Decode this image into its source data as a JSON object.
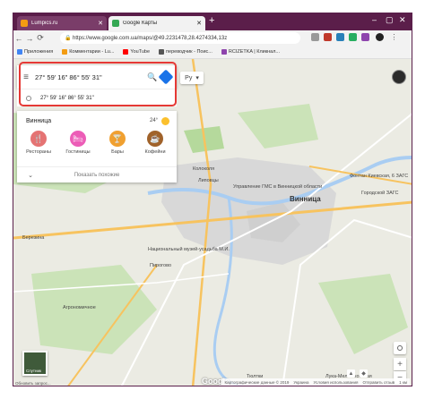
{
  "tabs": [
    {
      "label": "Lumpics.ru",
      "active": false,
      "color": "#f39c12"
    },
    {
      "label": "Google Карты",
      "active": true,
      "color": "#34a853"
    }
  ],
  "omnibox": {
    "url": "https://www.google.com.ua/maps/@49.2231478,28.4274334,13z"
  },
  "bookmarks": [
    {
      "label": "Приложения",
      "color": "#4285f4"
    },
    {
      "label": "Комментарии - Lu...",
      "color": "#f39c12"
    },
    {
      "label": "YouTube",
      "color": "#ff0000"
    },
    {
      "label": "переводчик - Поис...",
      "color": "#555555"
    },
    {
      "label": "RCIZETKA | Кликнал...",
      "color": "#8e44ad"
    }
  ],
  "search": {
    "query": "27° 59' 16\" 86° 55' 31\"",
    "suggestion": "27° 59' 16\" 86° 55' 31\""
  },
  "lang": {
    "label": "Ру"
  },
  "panel": {
    "city": "Винница",
    "temp": "24°",
    "categories": [
      {
        "label": "Рестораны",
        "icon": "fork-icon",
        "color": "#e57373",
        "glyph": "🍴"
      },
      {
        "label": "Гостиницы",
        "icon": "bed-icon",
        "color": "#ec5db7",
        "glyph": "🛏"
      },
      {
        "label": "Бары",
        "icon": "cocktail-icon",
        "color": "#f0a030",
        "glyph": "🍸"
      },
      {
        "label": "Кофейни",
        "icon": "coffee-icon",
        "color": "#a0622a",
        "glyph": "☕"
      }
    ],
    "more": "Показать похожие"
  },
  "map_labels": {
    "vinnitsa": "Винница",
    "lipovtsy": "Липовцы",
    "upravlenie": "Управление ГМС в Винницкой области",
    "kolokolnya": "Колоколя",
    "museum": "Национальный музей-усадьба М.И.",
    "pyrogovo": "Пирогово",
    "agronomichne": "Агрономичное",
    "berezhna": "Березина",
    "lukamelesh": "Лука-Мелешковская",
    "fontan": "Фонтан Киевская, 6 ЗАГС",
    "gorodskoy": "Городской ЗАГС",
    "tyuvky": "Тюлтки"
  },
  "satellite": {
    "label": "Спутник"
  },
  "google_logo": "Google",
  "footer": {
    "left": "Обновить запрос...",
    "right": [
      "Картографические данные © 2019",
      "Украина",
      "Условия использования",
      "Отправить отзыв",
      "1 км"
    ]
  },
  "colors": {
    "chrome_frame": "#5b1e4a",
    "highlight_red": "#e53935",
    "map_bg": "#e8e8e0"
  }
}
